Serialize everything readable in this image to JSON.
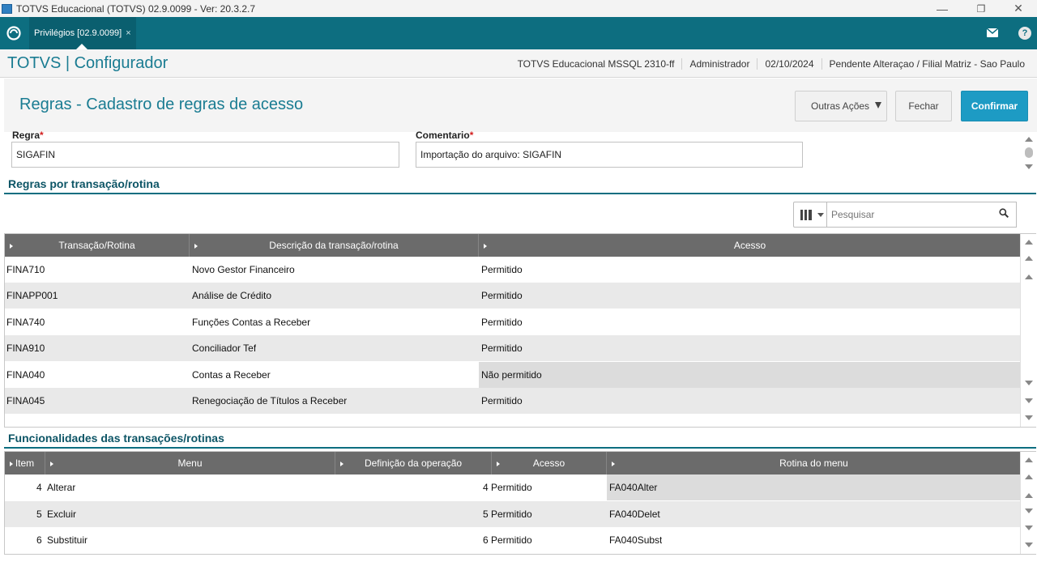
{
  "window": {
    "title": "TOTVS Educacional (TOTVS) 02.9.0099 - Ver: 20.3.2.7",
    "minimize": "—",
    "restore": "❐",
    "close": "✕"
  },
  "tabbar": {
    "tab_label": "Privilégios [02.9.0099]",
    "tab_close": "×",
    "help": "?"
  },
  "app": {
    "title": "TOTVS | Configurador",
    "environment": "TOTVS Educacional MSSQL 2310-ff",
    "user": "Administrador",
    "date": "02/10/2024",
    "branch": "Pendente Alteraçao / Filial Matriz - Sao Paulo"
  },
  "page": {
    "title": "Regras - Cadastro de regras de acesso",
    "buttons": {
      "outras_acoes": "Outras Ações",
      "fechar": "Fechar",
      "confirmar": "Confirmar"
    }
  },
  "form": {
    "regra_label": "Regra",
    "regra_value": "SIGAFIN",
    "comentario_label": "Comentario",
    "comentario_value": "Importação do arquivo: SIGAFIN",
    "required_mark": "*"
  },
  "section1": {
    "title": "Regras por transação/rotina",
    "search_placeholder": "Pesquisar",
    "columns": [
      "Transação/Rotina",
      "Descrição da transação/rotina",
      "Acesso"
    ],
    "rows": [
      {
        "code": "FINA710",
        "desc": "Novo Gestor Financeiro",
        "access": "Permitido"
      },
      {
        "code": "FINAPP001",
        "desc": "Análise de Crédito",
        "access": "Permitido"
      },
      {
        "code": "FINA740",
        "desc": "Funções Contas a Receber",
        "access": "Permitido"
      },
      {
        "code": "FINA910",
        "desc": "Conciliador Tef",
        "access": "Permitido"
      },
      {
        "code": "FINA040",
        "desc": "Contas a Receber",
        "access": "Não permitido"
      },
      {
        "code": "FINA045",
        "desc": "Renegociação de Títulos a Receber",
        "access": "Permitido"
      }
    ]
  },
  "section2": {
    "title": "Funcionalidades das transações/rotinas",
    "columns": [
      "Item",
      "Menu",
      "Definição da operação",
      "Acesso",
      "Rotina do menu"
    ],
    "rows": [
      {
        "item": "4",
        "menu": "Alterar",
        "def": "",
        "access": "4  Permitido",
        "routine": "FA040Alter"
      },
      {
        "item": "5",
        "menu": "Excluir",
        "def": "",
        "access": "5  Permitido",
        "routine": "FA040Delet"
      },
      {
        "item": "6",
        "menu": "Substituir",
        "def": "",
        "access": "6  Permitido",
        "routine": "FA040Subst"
      }
    ]
  },
  "colors": {
    "teal": "#0d6e80",
    "title_blue": "#1a7c92",
    "confirm": "#1d9bc4",
    "grid_header": "#6b6b6b"
  },
  "icons": [
    "app-icon",
    "totvs-logo-icon",
    "mail-icon",
    "help-icon",
    "columns-icon",
    "search-icon",
    "scroll-up-icon",
    "scroll-down-icon"
  ]
}
